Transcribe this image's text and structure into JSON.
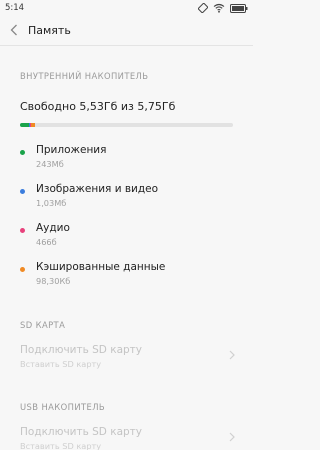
{
  "status": {
    "time": "5:14",
    "icons": [
      "rotate-icon",
      "wifi-icon",
      "battery-icon"
    ]
  },
  "header": {
    "back_icon": "chevron-left-icon",
    "title": "Память"
  },
  "internal": {
    "section_title": "ВНУТРЕННИЙ НАКОПИТЕЛЬ",
    "summary": "Свободно 5,53Гб из 5,75Гб",
    "usage_bar": {
      "segments": [
        {
          "name": "Приложения",
          "fraction": 0.04,
          "color": "#1aa34a"
        },
        {
          "name": "Изображения и видео",
          "fraction": 0.006,
          "color": "#3b7ddd"
        },
        {
          "name": "Аудио",
          "fraction": 0.006,
          "color": "#e8427c"
        },
        {
          "name": "Кэшированные данные",
          "fraction": 0.02,
          "color": "#f08a24"
        }
      ],
      "track_color": "#e2e2e2"
    },
    "items": [
      {
        "label": "Приложения",
        "size": "243Мб",
        "color": "#1aa34a"
      },
      {
        "label": "Изображения и видео",
        "size": "1,03Мб",
        "color": "#3b7ddd"
      },
      {
        "label": "Аудио",
        "size": "466б",
        "color": "#e8427c"
      },
      {
        "label": "Кэшированные данные",
        "size": "98,30Кб",
        "color": "#f08a24"
      }
    ]
  },
  "sd": {
    "section_title": "SD КАРТА",
    "item": {
      "label": "Подключить SD карту",
      "sub": "Вставить SD карту"
    }
  },
  "usb": {
    "section_title": "USB НАКОПИТЕЛЬ",
    "item": {
      "label": "Подключить SD карту",
      "sub": "Вставить SD карту"
    }
  }
}
